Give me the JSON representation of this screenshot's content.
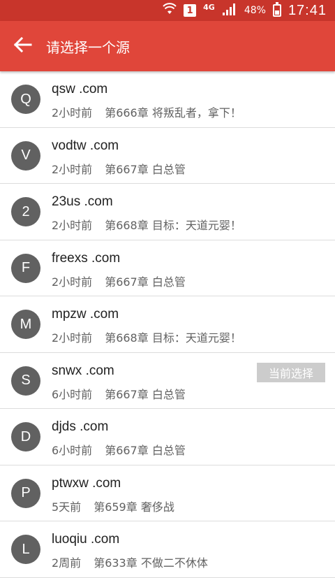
{
  "status_bar": {
    "sim_label": "1",
    "network": "4G",
    "battery": "48%",
    "time": "17:41"
  },
  "app_bar": {
    "title": "请选择一个源"
  },
  "sources": [
    {
      "letter": "Q",
      "name": "qsw .com",
      "time": "2小时前",
      "chapter": "第666章 将叛乱者，拿下！"
    },
    {
      "letter": "V",
      "name": "vodtw .com",
      "time": "2小时前",
      "chapter": "第667章 白总管"
    },
    {
      "letter": "2",
      "name": "23us .com",
      "time": "2小时前",
      "chapter": "第668章 目标：天道元婴！"
    },
    {
      "letter": "F",
      "name": "freexs .com",
      "time": "2小时前",
      "chapter": "第667章 白总管"
    },
    {
      "letter": "M",
      "name": "mpzw .com",
      "time": "2小时前",
      "chapter": "第668章 目标：天道元婴！"
    },
    {
      "letter": "S",
      "name": "snwx .com",
      "time": "6小时前",
      "chapter": "第667章 白总管",
      "badge": "当前选择"
    },
    {
      "letter": "D",
      "name": "djds .com",
      "time": "6小时前",
      "chapter": "第667章 白总管"
    },
    {
      "letter": "P",
      "name": "ptwxw .com",
      "time": "5天前",
      "chapter": "第659章 奢侈战"
    },
    {
      "letter": "L",
      "name": "luoqiu .com",
      "time": "2周前",
      "chapter": "第633章 不做二不休体"
    }
  ],
  "colors": {
    "status_bar": "#c8352b",
    "app_bar": "#e0463a",
    "avatar": "#616161",
    "badge": "#cccccc"
  }
}
